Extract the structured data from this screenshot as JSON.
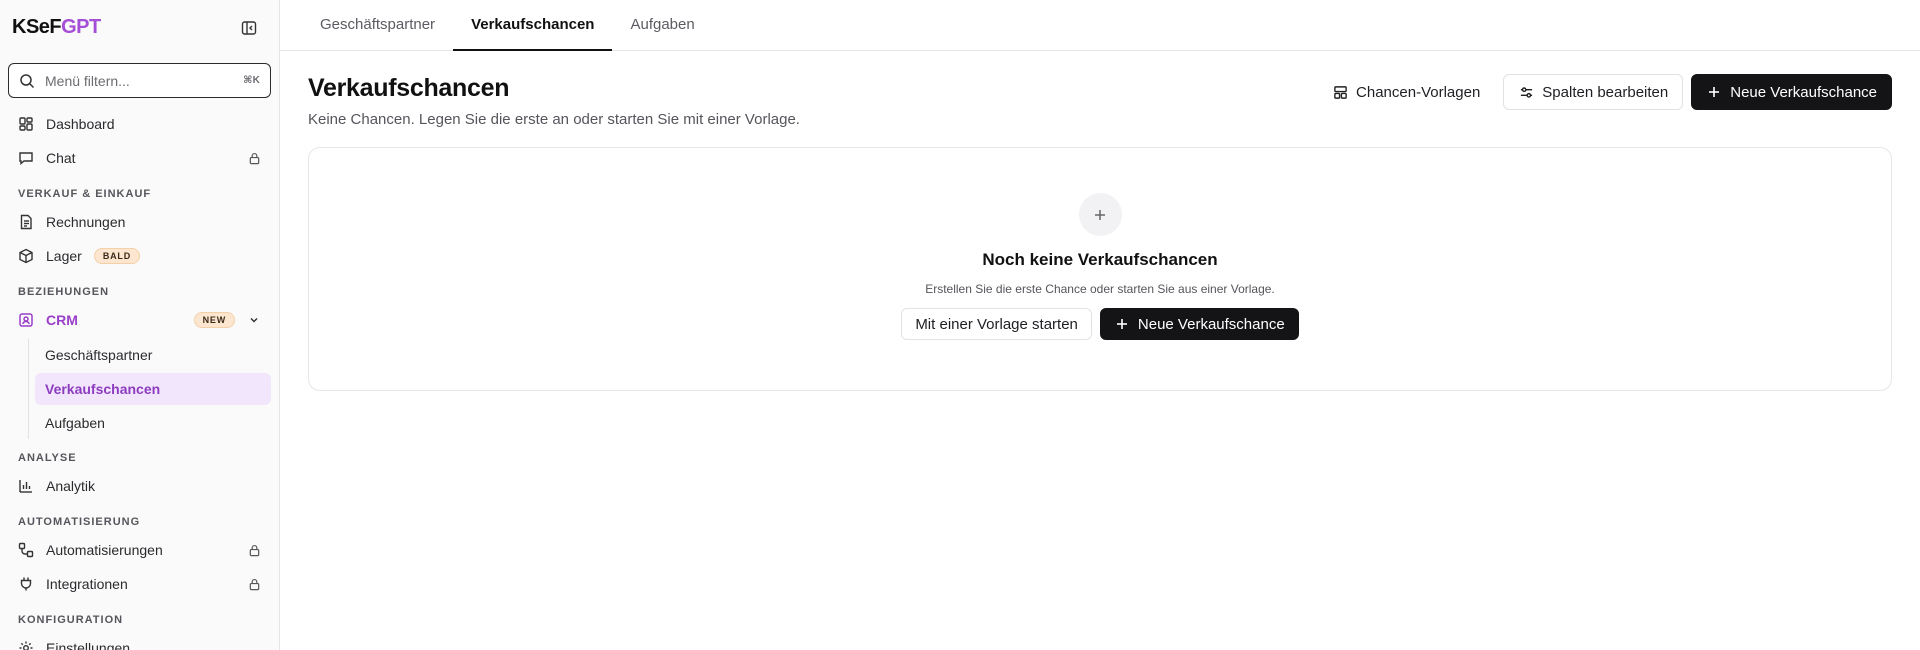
{
  "brand": {
    "prefix": "KSeF",
    "suffix": "GPT"
  },
  "search": {
    "placeholder": "Menü filtern...",
    "shortcut": "⌘K"
  },
  "nav": {
    "dashboard": "Dashboard",
    "chat": "Chat",
    "section_sales": "VERKAUF & EINKAUF",
    "invoices": "Rechnungen",
    "stock": "Lager",
    "stock_badge": "BALD",
    "section_relations": "BEZIEHUNGEN",
    "crm": "CRM",
    "crm_badge": "NEW",
    "crm_sub": [
      "Geschäftspartner",
      "Verkaufschancen",
      "Aufgaben"
    ],
    "section_analysis": "ANALYSE",
    "analytics": "Analytik",
    "section_automation": "AUTOMATISIERUNG",
    "automations": "Automatisierungen",
    "integrations": "Integrationen",
    "section_config": "KONFIGURATION",
    "settings": "Einstellungen"
  },
  "tabs": [
    "Geschäftspartner",
    "Verkaufschancen",
    "Aufgaben"
  ],
  "page": {
    "title": "Verkaufschancen",
    "subtitle": "Keine Chancen. Legen Sie die erste an oder starten Sie mit einer Vorlage."
  },
  "toolbar": {
    "templates": "Chancen-Vorlagen",
    "edit_columns": "Spalten bearbeiten",
    "new": "Neue Verkaufschance"
  },
  "empty": {
    "title": "Noch keine Verkaufschancen",
    "subtitle": "Erstellen Sie die erste Chance oder starten Sie aus einer Vorlage.",
    "template_button": "Mit einer Vorlage starten",
    "new_button": "Neue Verkaufschance"
  },
  "colors": {
    "accent": "#9a3fc9",
    "dark": "#141416",
    "active_bg": "#f1e6fb"
  }
}
